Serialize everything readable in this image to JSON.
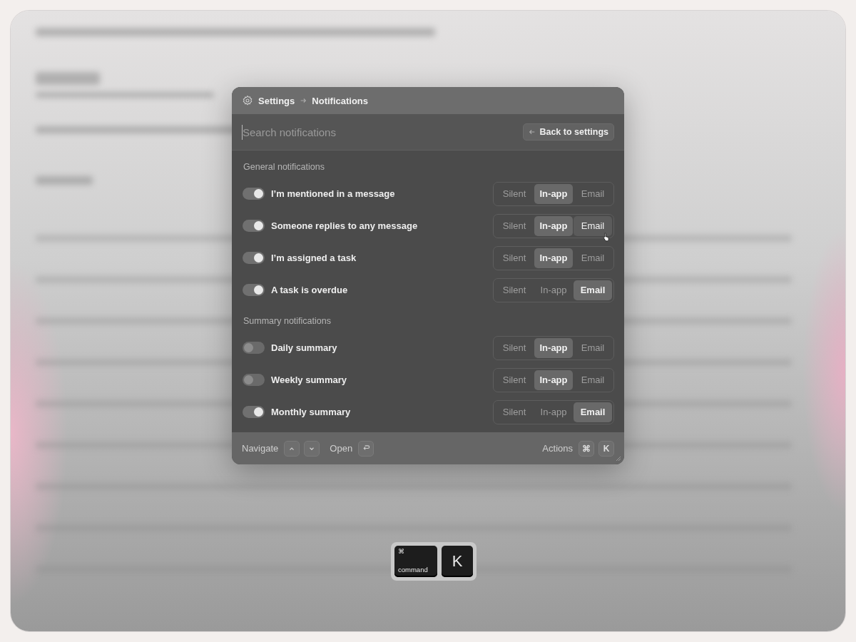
{
  "breadcrumb": {
    "root": "Settings",
    "current": "Notifications"
  },
  "search": {
    "placeholder": "Search notifications"
  },
  "back_button": {
    "label": "Back to settings"
  },
  "sections": [
    {
      "title": "General notifications",
      "rows": [
        {
          "label": "I’m mentioned in a message",
          "on": true,
          "options": [
            {
              "label": "Silent",
              "selected": false,
              "hovered": false
            },
            {
              "label": "In-app",
              "selected": true,
              "hovered": false
            },
            {
              "label": "Email",
              "selected": false,
              "hovered": false
            }
          ]
        },
        {
          "label": "Someone replies to any message",
          "on": true,
          "options": [
            {
              "label": "Silent",
              "selected": false,
              "hovered": false
            },
            {
              "label": "In-app",
              "selected": true,
              "hovered": false
            },
            {
              "label": "Email",
              "selected": false,
              "hovered": true
            }
          ]
        },
        {
          "label": "I’m assigned a task",
          "on": true,
          "options": [
            {
              "label": "Silent",
              "selected": false,
              "hovered": false
            },
            {
              "label": "In-app",
              "selected": true,
              "hovered": false
            },
            {
              "label": "Email",
              "selected": false,
              "hovered": false
            }
          ]
        },
        {
          "label": "A task is overdue",
          "on": true,
          "options": [
            {
              "label": "Silent",
              "selected": false,
              "hovered": false
            },
            {
              "label": "In-app",
              "selected": false,
              "hovered": false
            },
            {
              "label": "Email",
              "selected": true,
              "hovered": false
            }
          ]
        }
      ]
    },
    {
      "title": "Summary notifications",
      "rows": [
        {
          "label": "Daily summary",
          "on": false,
          "options": [
            {
              "label": "Silent",
              "selected": false,
              "hovered": false
            },
            {
              "label": "In-app",
              "selected": true,
              "hovered": false
            },
            {
              "label": "Email",
              "selected": false,
              "hovered": false
            }
          ]
        },
        {
          "label": "Weekly summary",
          "on": false,
          "options": [
            {
              "label": "Silent",
              "selected": false,
              "hovered": false
            },
            {
              "label": "In-app",
              "selected": true,
              "hovered": false
            },
            {
              "label": "Email",
              "selected": false,
              "hovered": false
            }
          ]
        },
        {
          "label": "Monthly summary",
          "on": true,
          "options": [
            {
              "label": "Silent",
              "selected": false,
              "hovered": false
            },
            {
              "label": "In-app",
              "selected": false,
              "hovered": false
            },
            {
              "label": "Email",
              "selected": true,
              "hovered": false
            }
          ]
        }
      ]
    }
  ],
  "footer": {
    "navigate": "Navigate",
    "open": "Open",
    "actions": "Actions",
    "actions_keys": [
      "⌘",
      "K"
    ]
  },
  "keycaps": [
    {
      "kind": "modifier",
      "symbol": "⌘",
      "label": "command"
    },
    {
      "kind": "letter",
      "label": "K"
    }
  ]
}
